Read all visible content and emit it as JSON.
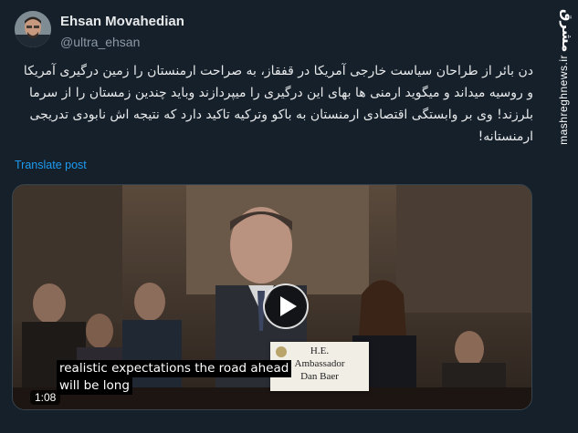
{
  "author": {
    "name": "Ehsan Movahedian",
    "handle": "@ultra_ehsan"
  },
  "tweet": {
    "text": "دن بائر از طراحان سیاست خارجی آمریکا در قفقاز، به صراحت ارمنستان را زمین درگیری آمریکا و روسیه میداند و میگوید ارمنی ها بهای این درگیری را میپردازند وباید چندین زمستان را از سرما بلرزند! وی بر وابستگی اقتصادی ارمنستان به باکو وترکیه تاکید دارد که نتیجه اش نابودی تدریجی ارمنستانه!",
    "translate_label": "Translate post"
  },
  "video": {
    "caption_line1": "realistic expectations the road ahead",
    "caption_line2": "will be long",
    "duration": "1:08",
    "placard_line1": "H.E.",
    "placard_line2": "Ambassador",
    "placard_line3": "Dan Baer"
  },
  "watermark": {
    "logo_text": "مشرق",
    "url": "mashreghnews.ir"
  },
  "colors": {
    "background": "#15202b",
    "link": "#1d9bf0",
    "secondary_text": "#8b98a5"
  }
}
